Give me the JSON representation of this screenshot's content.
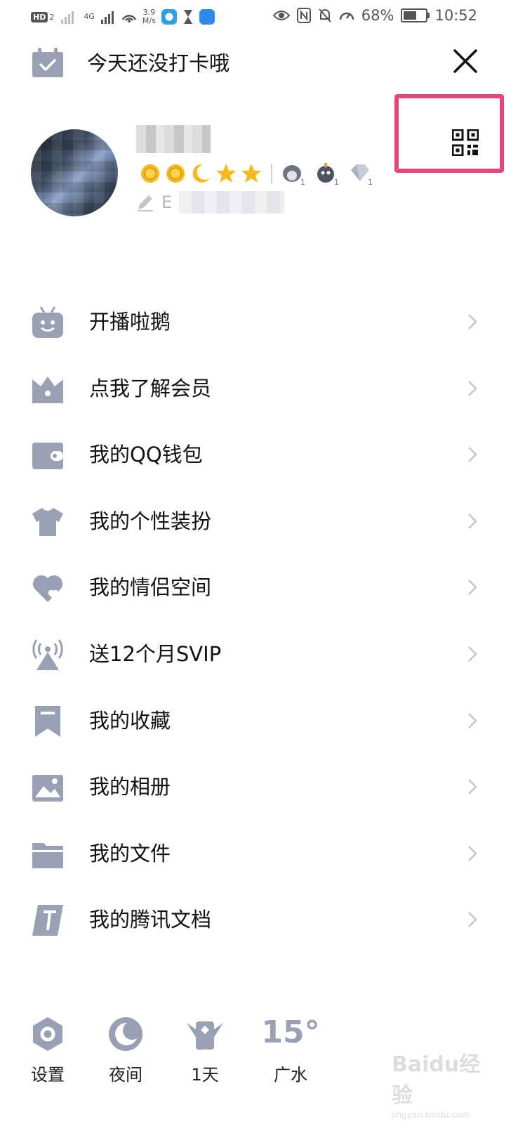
{
  "status_bar": {
    "hd": "HD",
    "hd_sub": "2",
    "network": "4G",
    "speed_value": "3.9",
    "speed_unit": "M/s",
    "battery": "68%",
    "battery_level": 0.68,
    "time": "10:52"
  },
  "header": {
    "checkin_text": "今天还没打卡哦"
  },
  "profile": {
    "signature_prefix": "E",
    "level_icons": [
      "sun-icon",
      "sun-icon",
      "moon-icon",
      "star-icon",
      "star-icon"
    ],
    "pet_badges": [
      {
        "icon": "penguin-badge-icon",
        "count": "1"
      },
      {
        "icon": "penguin-bomb-badge-icon",
        "count": "1"
      },
      {
        "icon": "diamond-badge-icon",
        "count": "1"
      }
    ]
  },
  "menu": {
    "items": [
      {
        "label": "开播啦鹅",
        "icon": "tv-robot-icon"
      },
      {
        "label": "点我了解会员",
        "icon": "crown-icon"
      },
      {
        "label": "我的QQ钱包",
        "icon": "wallet-icon"
      },
      {
        "label": "我的个性装扮",
        "icon": "tshirt-icon"
      },
      {
        "label": "我的情侣空间",
        "icon": "heart-icon"
      },
      {
        "label": "送12个月SVIP",
        "icon": "broadcast-icon"
      },
      {
        "label": "我的收藏",
        "icon": "bookmark-icon"
      },
      {
        "label": "我的相册",
        "icon": "photo-icon"
      },
      {
        "label": "我的文件",
        "icon": "folder-icon"
      },
      {
        "label": "我的腾讯文档",
        "icon": "document-icon"
      }
    ]
  },
  "bottom_bar": {
    "settings_label": "设置",
    "night_label": "夜间",
    "days_label": "1天",
    "temperature": "15°",
    "city": "广水"
  },
  "watermark": {
    "text": "Baidu经验",
    "sub": "jingyan.baidu.com"
  },
  "colors": {
    "icon_gray": "#9aa0b4",
    "highlight": "#e8457a",
    "text": "#111111",
    "arrow": "#c4c4cc"
  }
}
